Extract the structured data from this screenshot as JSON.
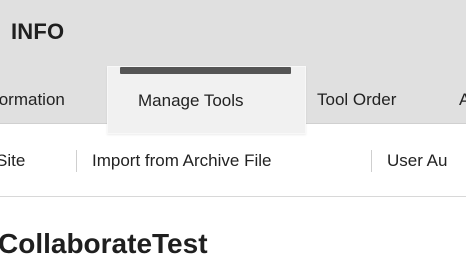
{
  "header": {
    "title": "INFO"
  },
  "tabs": [
    {
      "label": "formation"
    },
    {
      "label": "Manage Tools",
      "active": true
    },
    {
      "label": "Tool Order"
    },
    {
      "label": "A"
    }
  ],
  "subtabs": [
    {
      "label": "Site"
    },
    {
      "label": "Import from Archive File"
    },
    {
      "label": "User Au"
    }
  ],
  "site": {
    "name": "CollaborateTest"
  },
  "colors": {
    "header_background": "#e0e0e0",
    "active_tab_background": "#f1f1f1",
    "active_tab_indicator": "#555555"
  }
}
